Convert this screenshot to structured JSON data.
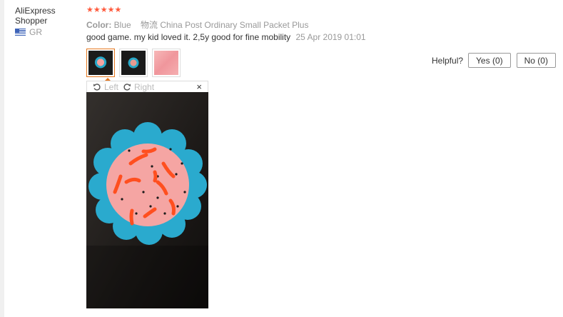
{
  "user": {
    "name": "AliExpress Shopper",
    "country_code": "GR"
  },
  "review": {
    "stars": "★★★★★",
    "rating": 5,
    "color_label": "Color:",
    "color_value": "Blue",
    "logistics": "物流 China Post Ordinary Small Packet Plus",
    "text": "good game. my kid loved it. 2,5y good for fine mobility",
    "date": "25 Apr 2019 01:01"
  },
  "viewer": {
    "rotate_left": "Left",
    "rotate_right": "Right",
    "close": "×"
  },
  "helpful": {
    "label": "Helpful?",
    "yes": "Yes (0)",
    "no": "No (0)"
  },
  "colors": {
    "star": "#ff5a3c",
    "active_thumb_border": "#e5761e"
  }
}
